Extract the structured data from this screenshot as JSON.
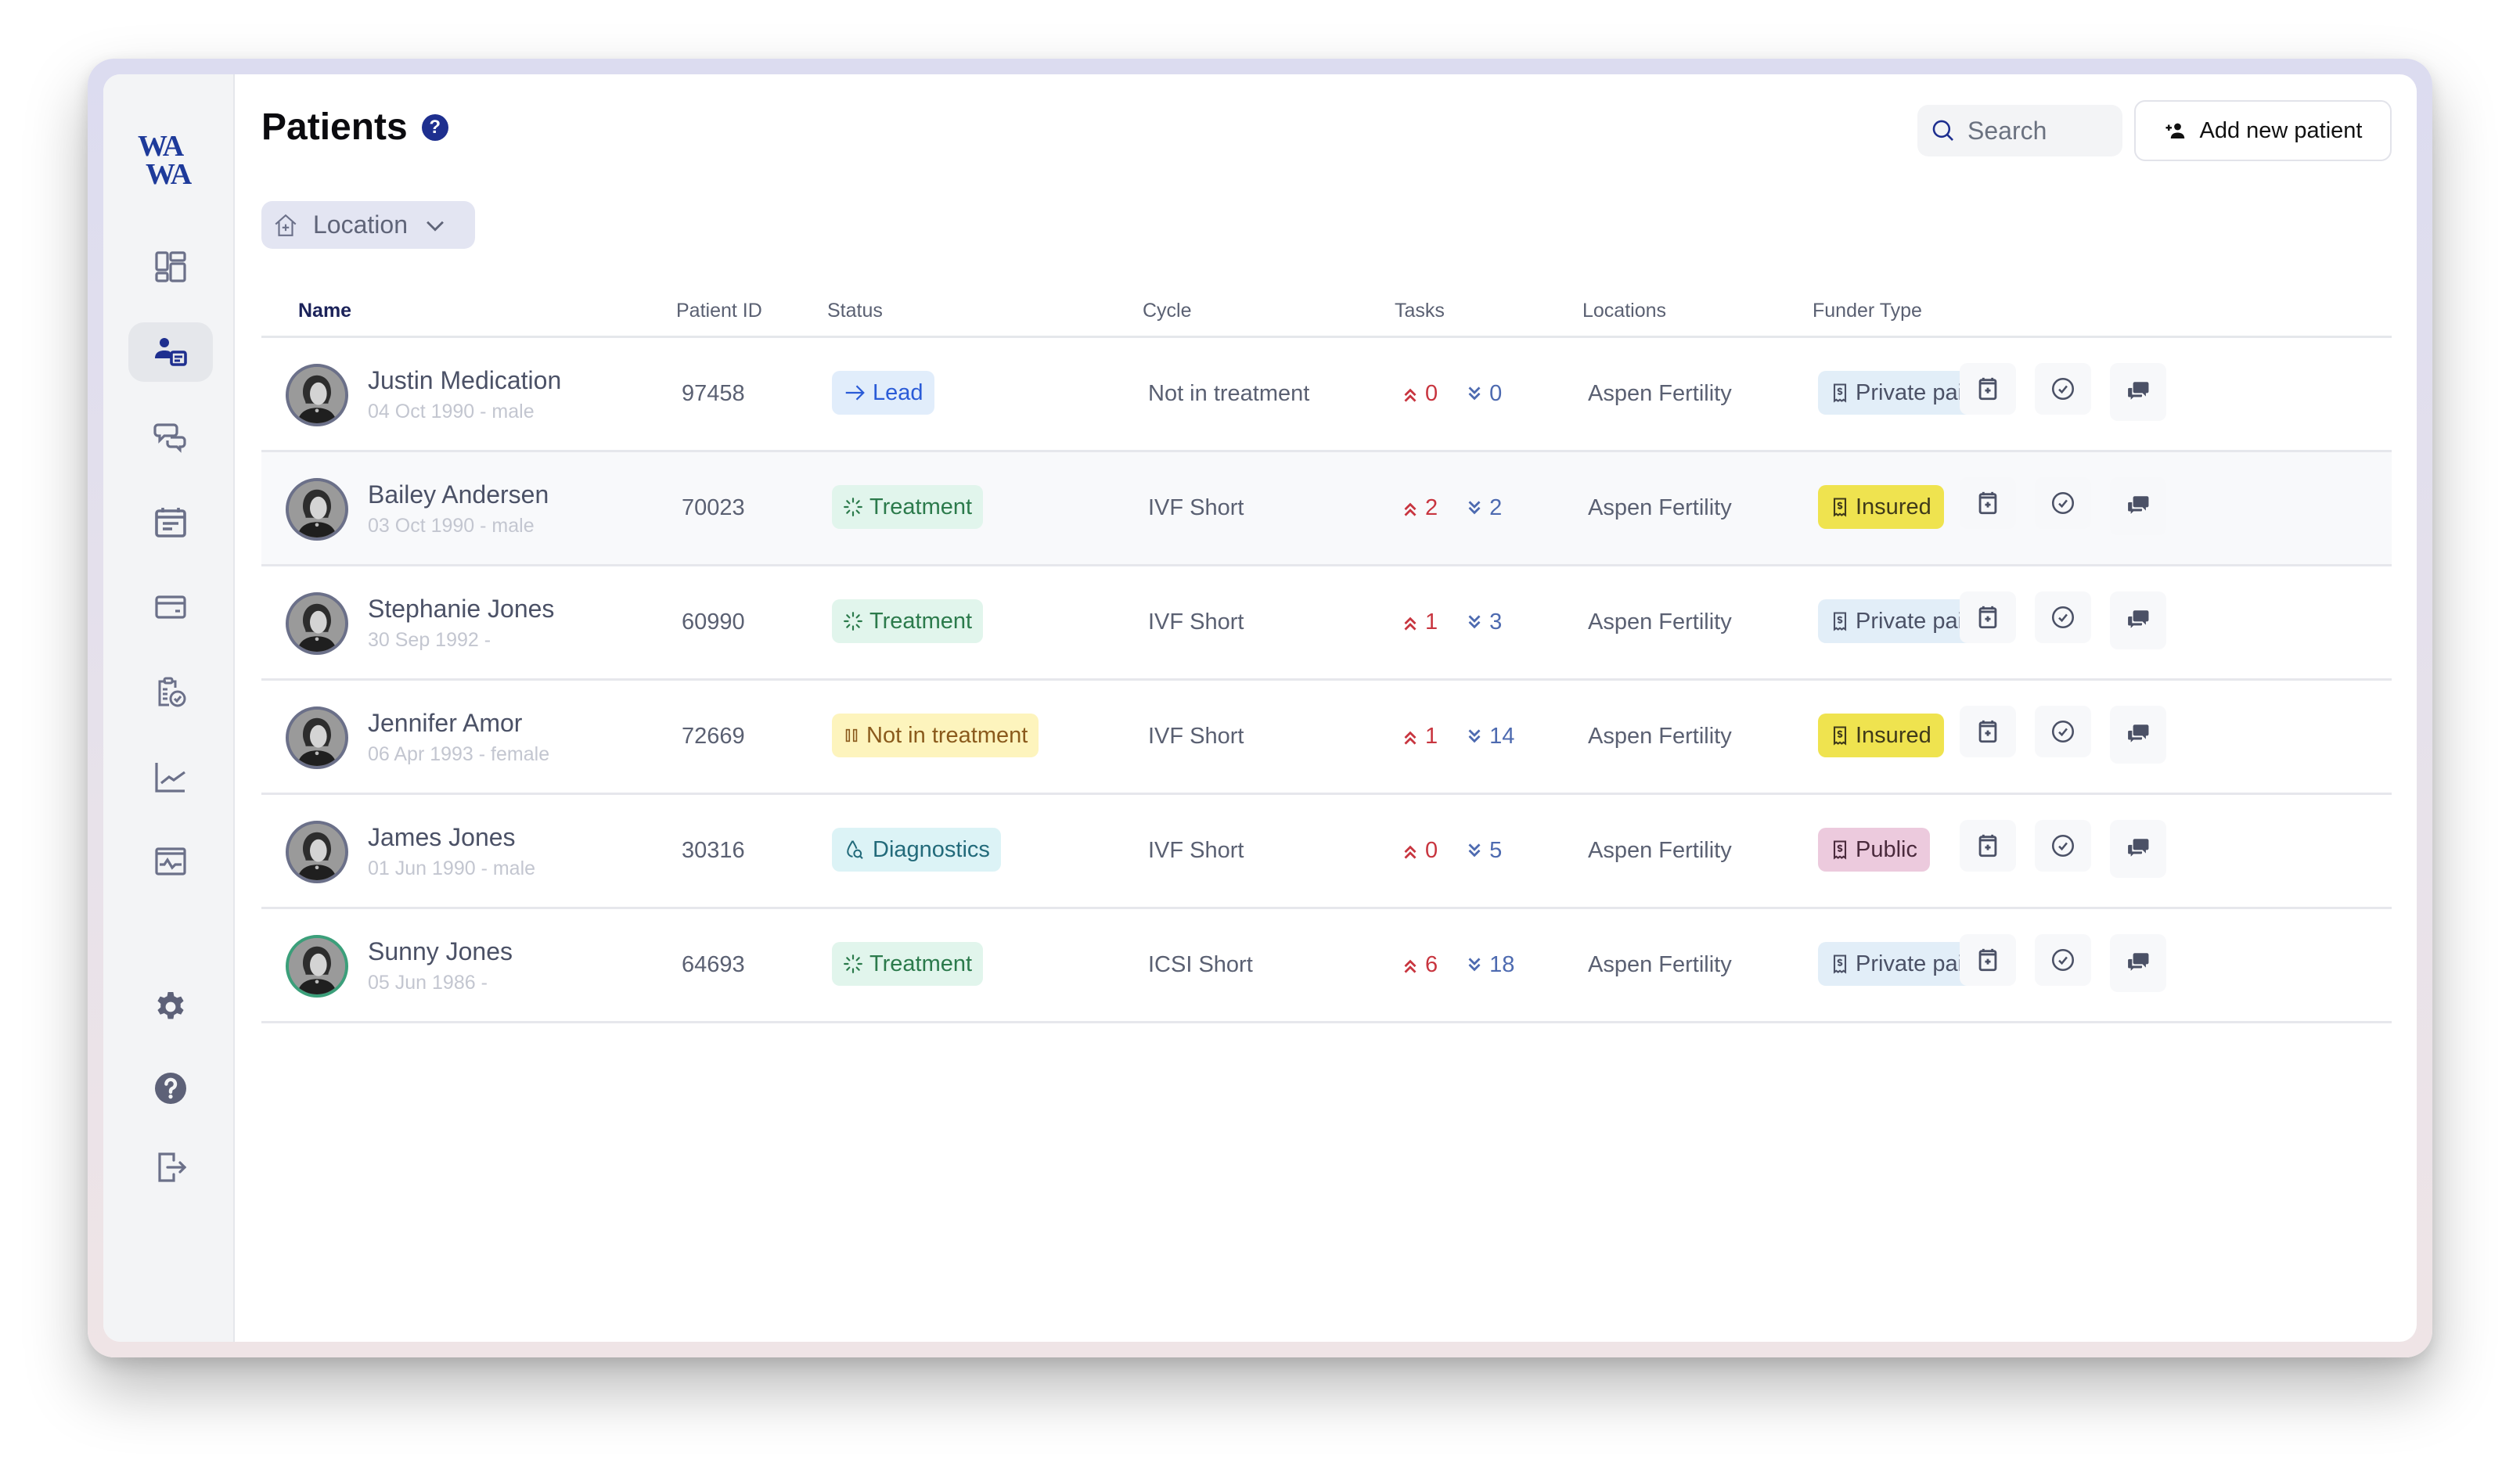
{
  "app": {
    "logo_line1": "WA",
    "logo_line2": "WA"
  },
  "sidebar": {
    "items": [
      {
        "name": "dashboard",
        "icon": "dashboard-icon",
        "active": false
      },
      {
        "name": "patients",
        "icon": "patients-icon",
        "active": true
      },
      {
        "name": "messages",
        "icon": "chat-icon",
        "active": false
      },
      {
        "name": "calendar",
        "icon": "calendar-icon",
        "active": false
      },
      {
        "name": "billing",
        "icon": "credit-card-icon",
        "active": false
      },
      {
        "name": "tasks",
        "icon": "clipboard-check-icon",
        "active": false
      },
      {
        "name": "analytics",
        "icon": "chart-line-icon",
        "active": false
      },
      {
        "name": "monitoring",
        "icon": "monitor-pulse-icon",
        "active": false
      }
    ],
    "bottom_items": [
      {
        "name": "settings",
        "icon": "gear-icon"
      },
      {
        "name": "help",
        "icon": "help-icon"
      },
      {
        "name": "logout",
        "icon": "logout-icon"
      }
    ]
  },
  "header": {
    "title": "Patients",
    "help_glyph": "?",
    "search_placeholder": "Search",
    "add_button_label": "Add new patient"
  },
  "filters": {
    "location_label": "Location"
  },
  "table": {
    "columns": [
      "Name",
      "Patient ID",
      "Status",
      "Cycle",
      "Tasks",
      "Locations",
      "Funder Type"
    ],
    "rows": [
      {
        "name": "Justin Medication",
        "meta": "04 Oct 1990 - male",
        "patient_id": "97458",
        "status": "Lead",
        "status_type": "lead",
        "cycle": "Not in treatment",
        "tasks_up": "0",
        "tasks_down": "0",
        "location": "Aspen Fertility",
        "funder": "Private paid",
        "funder_type": "private",
        "avatar_ring": "gray"
      },
      {
        "name": "Bailey Andersen",
        "meta": "03 Oct 1990 - male",
        "patient_id": "70023",
        "status": "Treatment",
        "status_type": "treatment",
        "cycle": "IVF Short",
        "tasks_up": "2",
        "tasks_down": "2",
        "location": "Aspen Fertility",
        "funder": "Insured",
        "funder_type": "insured",
        "avatar_ring": "gray"
      },
      {
        "name": "Stephanie Jones",
        "meta": "30 Sep 1992 -",
        "patient_id": "60990",
        "status": "Treatment",
        "status_type": "treatment",
        "cycle": "IVF Short",
        "tasks_up": "1",
        "tasks_down": "3",
        "location": "Aspen Fertility",
        "funder": "Private paid",
        "funder_type": "private",
        "avatar_ring": "gray"
      },
      {
        "name": "Jennifer Amor",
        "meta": "06 Apr 1993 - female",
        "patient_id": "72669",
        "status": "Not in treatment",
        "status_type": "not-in-treatment",
        "cycle": "IVF Short",
        "tasks_up": "1",
        "tasks_down": "14",
        "location": "Aspen Fertility",
        "funder": "Insured",
        "funder_type": "insured",
        "avatar_ring": "gray"
      },
      {
        "name": "James Jones",
        "meta": "01 Jun 1990 - male",
        "patient_id": "30316",
        "status": "Diagnostics",
        "status_type": "diagnostics",
        "cycle": "IVF Short",
        "tasks_up": "0",
        "tasks_down": "5",
        "location": "Aspen Fertility",
        "funder": "Public",
        "funder_type": "public",
        "avatar_ring": "gray"
      },
      {
        "name": "Sunny Jones",
        "meta": "05 Jun 1986 -",
        "patient_id": "64693",
        "status": "Treatment",
        "status_type": "treatment",
        "cycle": "ICSI Short",
        "tasks_up": "6",
        "tasks_down": "18",
        "location": "Aspen Fertility",
        "funder": "Private paid",
        "funder_type": "private",
        "avatar_ring": "green"
      }
    ],
    "row_actions": [
      "add-appointment",
      "add-task",
      "open-chat"
    ]
  },
  "colors": {
    "brand": "#1e3a9a",
    "status": {
      "lead": {
        "bg": "#e1edfb",
        "fg": "#2a5bd7"
      },
      "treatment": {
        "bg": "#e1f5ec",
        "fg": "#2b7a4b"
      },
      "not-in-treatment": {
        "bg": "#fdf4bd",
        "fg": "#8a5a1c"
      },
      "diagnostics": {
        "bg": "#dcf3f6",
        "fg": "#226a7a"
      }
    },
    "funder": {
      "private": {
        "bg": "#e2eef8",
        "fg": "#4b5166"
      },
      "insured": {
        "bg": "#efe34f",
        "fg": "#3f3a1a"
      },
      "public": {
        "bg": "#eccadd",
        "fg": "#4a2a3c"
      }
    },
    "task_up": "#c8353f",
    "task_down": "#4d6ab0"
  }
}
